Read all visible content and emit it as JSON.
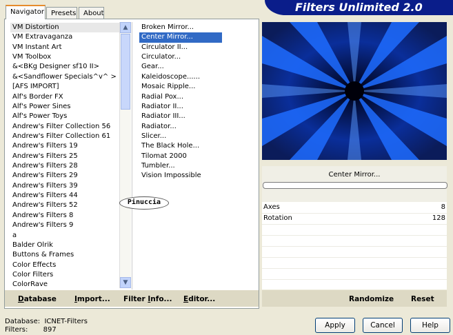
{
  "app": {
    "title": "Filters Unlimited 2.0"
  },
  "tabs": [
    {
      "label": "Navigator",
      "active": true
    },
    {
      "label": "Presets",
      "active": false
    },
    {
      "label": "About",
      "active": false
    }
  ],
  "categories": [
    "VM Distortion",
    "VM Extravaganza",
    "VM Instant Art",
    "VM Toolbox",
    "&<BKg Designer sf10 II>",
    "&<Sandflower Specials^v^ >",
    "[AFS IMPORT]",
    "Alf's Border FX",
    "Alf's Power Sines",
    "Alf's Power Toys",
    "Andrew's Filter Collection 56",
    "Andrew's Filter Collection 61",
    "Andrew's Filters 19",
    "Andrew's Filters 25",
    "Andrew's Filters 28",
    "Andrew's Filters 29",
    "Andrew's Filters 39",
    "Andrew's Filters 44",
    "Andrew's Filters 52",
    "Andrew's Filters 8",
    "Andrew's Filters 9",
    "a",
    "Balder Olrik",
    "Buttons & Frames",
    "Color Effects",
    "Color Filters",
    "ColorRave"
  ],
  "filters": [
    "Broken Mirror...",
    "Center Mirror...",
    "Circulator II...",
    "Circulator...",
    "Gear...",
    "Kaleidoscope......",
    "Mosaic Ripple...",
    "Radial Pox...",
    "Radiator II...",
    "Radiator III...",
    "Radiator...",
    "Slicer...",
    "The Black Hole...",
    "Tilomat 2000",
    "Tumbler...",
    "Vision Impossible"
  ],
  "selected_category_index": 0,
  "selected_filter_index": 1,
  "bottom_buttons": {
    "database_u": "D",
    "database_rest": "atabase",
    "import_u": "I",
    "import_rest": "mport...",
    "filterinfo_pre": "Filter ",
    "filterinfo_u": "I",
    "filterinfo_rest": "nfo...",
    "editor_u": "E",
    "editor_rest": "ditor..."
  },
  "preview": {
    "filter_name": "Center Mirror..."
  },
  "params": [
    {
      "label": "Axes",
      "value": "8"
    },
    {
      "label": "Rotation",
      "value": "128"
    }
  ],
  "randomize_label": "Randomize",
  "reset_label": "Reset",
  "status": {
    "database_label": "Database:",
    "database_value": "ICNET-Filters",
    "filters_label": "Filters:",
    "filters_value": "897"
  },
  "dialog_buttons": {
    "apply": "Apply",
    "cancel": "Cancel",
    "help": "Help"
  },
  "watermark": "Pinuccia",
  "colors": {
    "title_bg": "#0a1d8a",
    "selection": "#316ac5",
    "tab_accent": "#e68b2c",
    "preview_blue": "#1e6cff"
  }
}
